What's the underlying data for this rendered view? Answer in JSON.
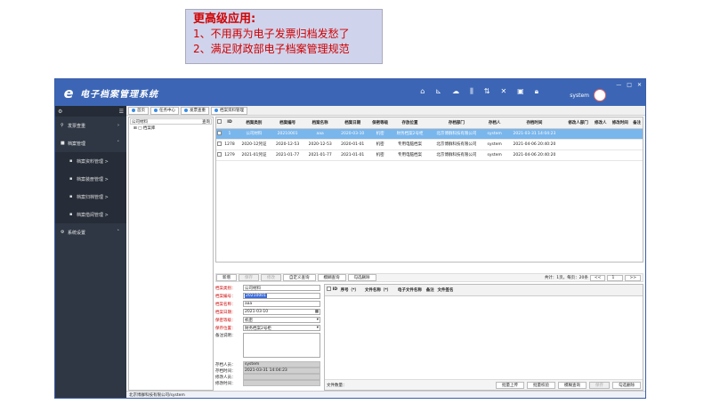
{
  "callout": {
    "heading": "更高级应用:",
    "line1": "1、不用再为电子发票归档发愁了",
    "line2": "2、满足财政部电子档案管理规范"
  },
  "app": {
    "title": "电子档案管理系统",
    "user": "system",
    "toolbar_icons": [
      "home-icon",
      "chart-icon",
      "cloud-icon",
      "columns-icon",
      "sort-icon",
      "close-x-icon",
      "package-icon",
      "lock-icon"
    ],
    "window_buttons": [
      "—",
      "□",
      "✕"
    ]
  },
  "sidebar": {
    "items": [
      {
        "label": "发票查重",
        "icon": "search-icon",
        "chev": "›"
      },
      {
        "label": "档案管理",
        "icon": "folder-icon",
        "chev": "˅"
      },
      {
        "label": "档案资料管理 >",
        "icon": "doc-icon",
        "sub": true
      },
      {
        "label": "档案装册管理 >",
        "icon": "doc-icon",
        "sub": true
      },
      {
        "label": "档案归档管理 >",
        "icon": "doc-icon",
        "sub": true
      },
      {
        "label": "档案借阅管理 >",
        "icon": "doc-icon",
        "sub": true
      },
      {
        "label": "系统设置",
        "icon": "gear-icon",
        "chev": "˄"
      }
    ]
  },
  "tabs": [
    "首页",
    "任务中心",
    "发票查重",
    "档案资料管理"
  ],
  "tree": {
    "input_value": "公司材料",
    "query_btn": "查询",
    "root": "⊞ □ 档案库"
  },
  "table": {
    "columns": [
      "ID",
      "档案类别",
      "档案编号",
      "档案名称",
      "档案日期",
      "保密等级",
      "存放位置",
      "存档部门",
      "存档人",
      "存档时间",
      "修改人部门",
      "修改人",
      "修改时间",
      "备注"
    ],
    "rows": [
      [
        "1",
        "公司材料",
        "20210001",
        "aaa",
        "2020-03-10",
        "机密",
        "财务档案2号柜",
        "北京博群科技有限公司",
        "system",
        "2021-03-31 14:04:23",
        "",
        "",
        "",
        ""
      ],
      [
        "1278",
        "2020-12凭证",
        "2020-12-53",
        "2020-12-53",
        "2020-01-01",
        "机密",
        "专用电脑档案",
        "北京博群科技有限公司",
        "system",
        "2021-04-06 20:40:20",
        "",
        "",
        "",
        ""
      ],
      [
        "1279",
        "2021-01凭证",
        "2021-01-77",
        "2021-01-77",
        "2021-01-01",
        "机密",
        "专用电脑档案",
        "北京博群科技有限公司",
        "system",
        "2021-04-06 20:40:20",
        "",
        "",
        "",
        ""
      ]
    ]
  },
  "actions": {
    "buttons": [
      "新增",
      "保存",
      "修改",
      "自定义查询",
      "模糊查询",
      "勾选删除"
    ],
    "pager_info": "共计：1页，每页：20条",
    "prev": "<<",
    "page": "1",
    "next": ">>"
  },
  "form": {
    "fields": [
      {
        "label": "档案类别：",
        "value": "公司材料",
        "red": true
      },
      {
        "label": "档案编号：",
        "value": "20210001",
        "red": true,
        "hl": true
      },
      {
        "label": "档案名称：",
        "value": "aaa",
        "red": true
      },
      {
        "label": "档案日期：",
        "value": "2021-03-10",
        "red": true,
        "date": true
      },
      {
        "label": "保密等级：",
        "value": "机密",
        "red": true,
        "sel": true
      },
      {
        "label": "保存位置：",
        "value": "财务档案2号柜",
        "red": true,
        "sel": true
      }
    ],
    "remark_label": "备注说明：",
    "readonly": [
      {
        "label": "存档人员：",
        "value": "system"
      },
      {
        "label": "存档时间：",
        "value": "2021-03-31 14:04:23"
      },
      {
        "label": "修改人员：",
        "value": ""
      },
      {
        "label": "修改时间：",
        "value": ""
      }
    ]
  },
  "files": {
    "columns": [
      "ID",
      "序号（*）",
      "文件名称（*）",
      "电子文件名称",
      "备注",
      "文件签名"
    ],
    "count_label": "文件数量：",
    "buttons": [
      "批量上传",
      "批量校验",
      "模糊查询",
      "保存",
      "勾选删除"
    ]
  },
  "status": "北京博群科技有限公司/system"
}
